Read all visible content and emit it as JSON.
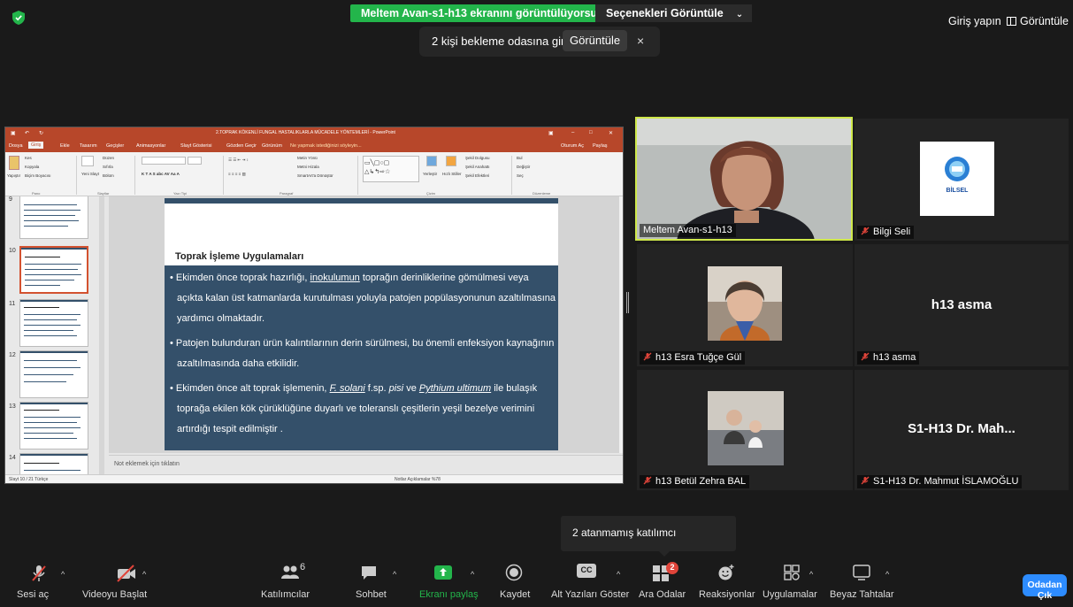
{
  "top": {
    "share_banner": "Meltem Avan-s1-h13 ekranını görüntülüyorsunuz",
    "view_options": "Seçenekleri Görüntüle",
    "waiting_text": "2 kişi bekleme odasına girdi",
    "waiting_view": "Görüntüle",
    "waiting_close": "×",
    "login": "Giriş yapın",
    "view": "Görüntüle"
  },
  "ppt": {
    "title": "2.TOPRAK KÖKENLİ FUNGAL HASTALIKLARLA MÜCADELE YÖNTEMLERİ - PowerPoint",
    "menu": [
      "Dosya",
      "Giriş",
      "Ekle",
      "Tasarım",
      "Geçişler",
      "Animasyonlar",
      "Slayt Gösterisi",
      "Gözden Geçir",
      "Görünüm",
      "Ne yapmak istediğinizi söyleyin..."
    ],
    "signin": "Oturum Aç",
    "share": "Paylaş",
    "ribbon": {
      "cut": "Kes",
      "copy": "Kopyala",
      "paste": "Yapıştır",
      "format_painter": "Biçim Boyacısı",
      "new_slide": "Yeni Slayt",
      "layout": "Düzen",
      "reset": "Sıfırla",
      "section": "Bölüm",
      "text_direction": "Metin Yönü",
      "align_text": "Metni Hizala",
      "smartart": "SmartArt'a Dönüştür",
      "arrange": "Yerleştir",
      "quick_styles": "Hızlı Stiller",
      "shape_fill": "Şekil Dolgusu",
      "shape_outline": "Şekil Anahattı",
      "shape_effects": "Şekil Efektleri",
      "find": "Bul",
      "replace": "Değiştir",
      "select": "Seç",
      "groups": [
        "Pano",
        "Slaytlar",
        "Yazı Tipi",
        "Paragraf",
        "Çizim",
        "Düzenleme"
      ]
    },
    "thumbs": [
      "9",
      "10",
      "11",
      "12",
      "13",
      "14"
    ],
    "slide": {
      "title": "Toprak İşleme Uygulamaları",
      "b1_l1_pre": "• Ekimden önce toprak hazırlığı, ",
      "b1_l1_u": "inokulumun",
      "b1_l1_post": " toprağın derinliklerine gömülmesi veya",
      "b1_l2": "açıkta kalan üst katmanlarda kurutulması yoluyla patojen popülasyonunun azaltılmasına",
      "b1_l3": "yardımcı olmaktadır.",
      "b2_l1": "• Patojen bulunduran ürün kalıntılarının derin sürülmesi, bu önemli enfeksiyon kaynağının",
      "b2_l2": "azaltılmasında daha etkilidir.",
      "b3_l1_pre": "• Ekimden önce alt toprak işlemenin, ",
      "b3_l1_i1": "F. solani",
      "b3_l1_mid": " f.sp. ",
      "b3_l1_i2": "pisi",
      "b3_l1_mid2": " ve ",
      "b3_l1_i3": "Pythium ultimum",
      "b3_l1_post": " ile bulaşık",
      "b3_l2": "toprağa ekilen kök çürüklüğüne duyarlı ve toleranslı çeşitlerin yeşil bezelye verimini",
      "b3_l3": "artırdığı tespit edilmiştir ."
    },
    "notes": "Not eklemek için tıklatın",
    "status_left": "Slayt 10 / 21    Türkçe",
    "status_right": "Notlar    Açıklamalar                               %78"
  },
  "gallery": [
    {
      "name": "Meltem Avan-s1-h13",
      "muted": false,
      "speaking": true
    },
    {
      "name": "Bilgi Seli",
      "muted": true,
      "logo": "BİLSEL"
    },
    {
      "name": "h13 Esra Tuğçe Gül",
      "muted": true
    },
    {
      "name": "h13 asma",
      "muted": true,
      "big": "h13 asma"
    },
    {
      "name": "h13 Betül Zehra BAL",
      "muted": true
    },
    {
      "name": "S1-H13 Dr. Mahmut İSLAMOĞLU",
      "muted": true,
      "big": "S1-H13 Dr. Mah..."
    }
  ],
  "unassigned": "2 atanmamış katılımcı",
  "toolbar": {
    "mute": "Sesi aç",
    "video": "Videoyu Başlat",
    "participants": "Katılımcılar",
    "participants_count": "6",
    "chat": "Sohbet",
    "share": "Ekranı paylaş",
    "record": "Kaydet",
    "captions": "Alt Yazıları Göster",
    "cc": "CC",
    "breakout": "Ara Odalar",
    "breakout_badge": "2",
    "reactions": "Reaksiyonlar",
    "apps": "Uygulamalar",
    "whiteboards": "Beyaz Tahtalar",
    "leave": "Odadan Çık"
  },
  "colors": {
    "share_green": "#23b54b",
    "ppt_red": "#b7472a",
    "slide_blue": "#34506a",
    "speaking": "#cfe84a",
    "leave_blue": "#2d8cff",
    "mute_red": "#e0443a"
  }
}
